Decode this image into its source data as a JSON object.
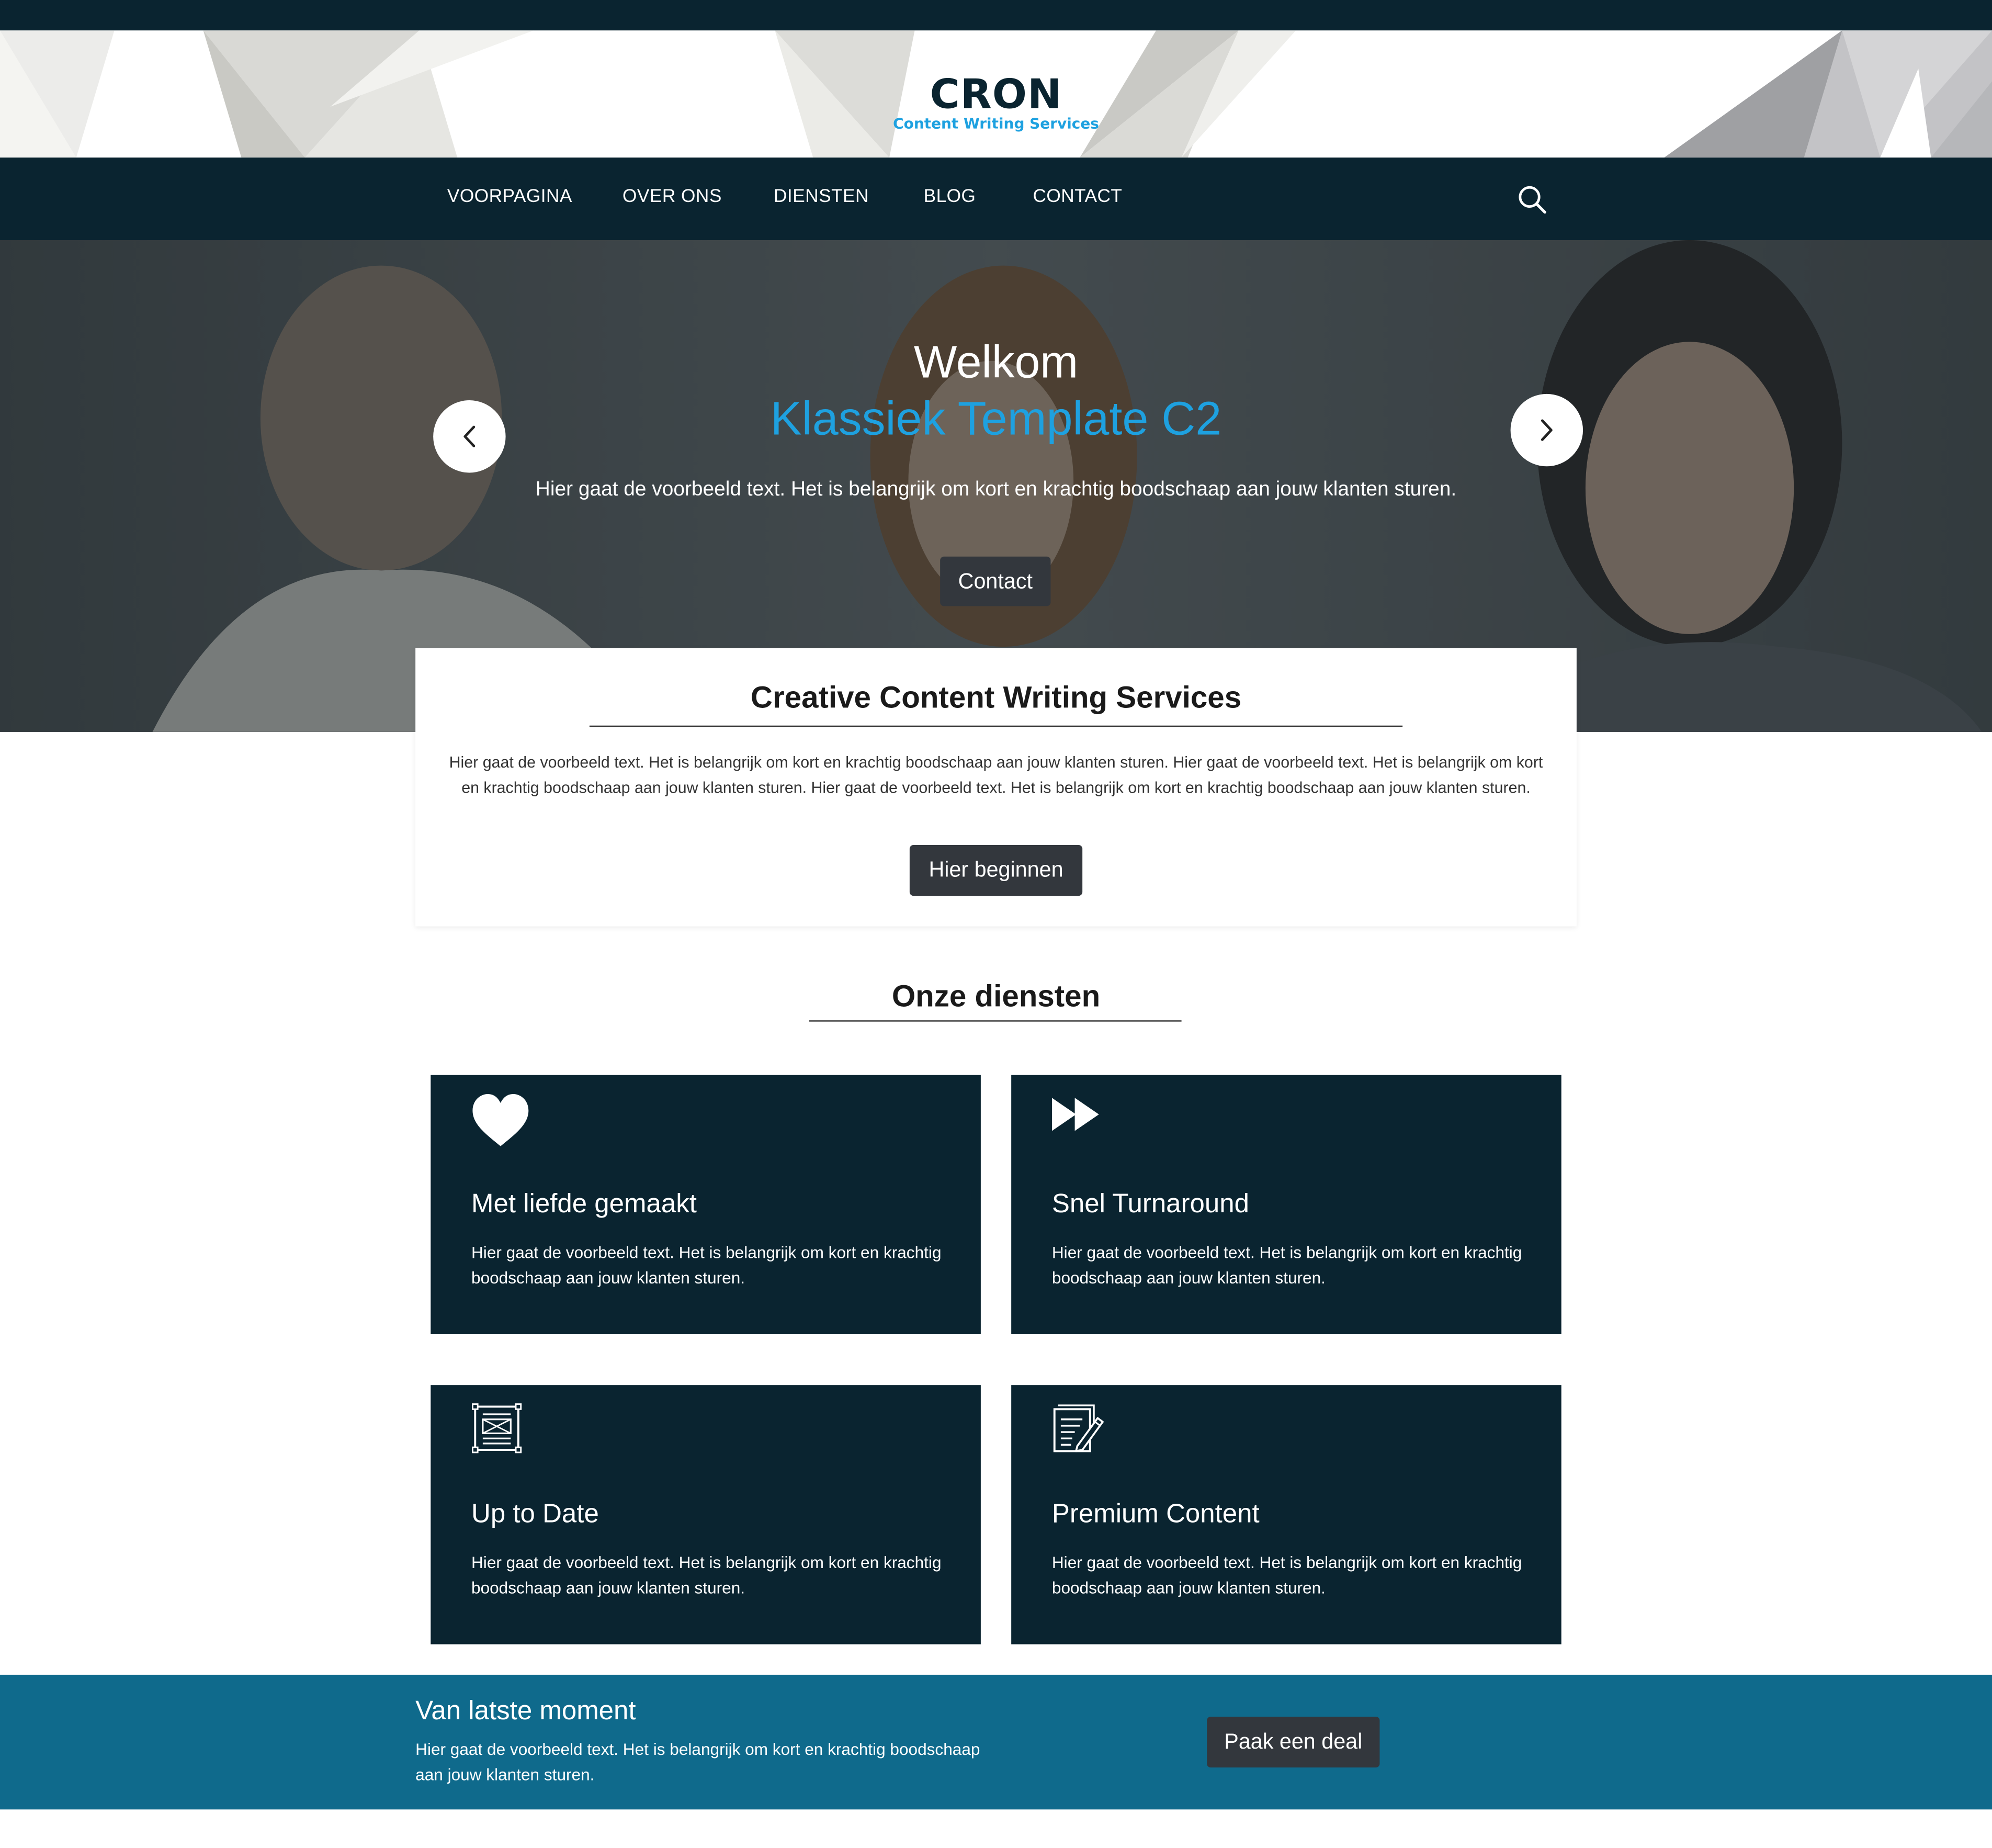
{
  "brand": {
    "title": "CRON",
    "subtitle": "Content Writing Services"
  },
  "nav": {
    "items": [
      {
        "label": "VOORPAGINA"
      },
      {
        "label": "OVER ONS"
      },
      {
        "label": "DIENSTEN"
      },
      {
        "label": "BLOG"
      },
      {
        "label": "CONTACT"
      }
    ],
    "search_icon": "search-icon"
  },
  "hero": {
    "title": "Welkom",
    "subtitle": "Klassiek Template C2",
    "text": "Hier gaat de voorbeeld text. Het is belangrijk om kort en krachtig boodschaap aan jouw klanten sturen.",
    "button": "Contact",
    "prev_icon": "chevron-left-icon",
    "next_icon": "chevron-right-icon"
  },
  "intro": {
    "title": "Creative Content Writing Services",
    "text": "Hier gaat de voorbeeld text. Het is belangrijk om kort en krachtig boodschaap aan jouw klanten sturen. Hier gaat de voorbeeld text. Het is belangrijk om kort en krachtig boodschaap aan jouw klanten sturen. Hier gaat de voorbeeld text. Het is belangrijk om kort en krachtig boodschaap aan jouw klanten sturen.",
    "button": "Hier beginnen"
  },
  "services": {
    "title": "Onze diensten",
    "items": [
      {
        "icon": "heart-icon",
        "title": "Met liefde gemaakt",
        "text": "Hier gaat de voorbeeld text. Het is belangrijk om kort en krachtig boodschaap aan jouw klanten sturen."
      },
      {
        "icon": "fast-forward-icon",
        "title": "Snel Turnaround",
        "text": "Hier gaat de voorbeeld text. Het is belangrijk om kort en krachtig boodschaap aan jouw klanten sturen."
      },
      {
        "icon": "newspaper-icon",
        "title": "Up to Date",
        "text": "Hier gaat de voorbeeld text. Het is belangrijk om kort en krachtig boodschaap aan jouw klanten sturen."
      },
      {
        "icon": "edit-document-icon",
        "title": "Premium Content",
        "text": "Hier gaat de voorbeeld text. Het is belangrijk om kort en krachtig boodschaap aan jouw klanten sturen."
      }
    ]
  },
  "deal": {
    "title": "Van latste moment",
    "text": "Hier gaat de voorbeeld text. Het is belangrijk om kort en krachtig boodschaap aan jouw klanten sturen.",
    "button": "Paak een deal"
  },
  "colors": {
    "navy": "#0a2430",
    "accent": "#1ea1e0",
    "button": "#33373d",
    "deal_band": "#0f6a8c"
  }
}
